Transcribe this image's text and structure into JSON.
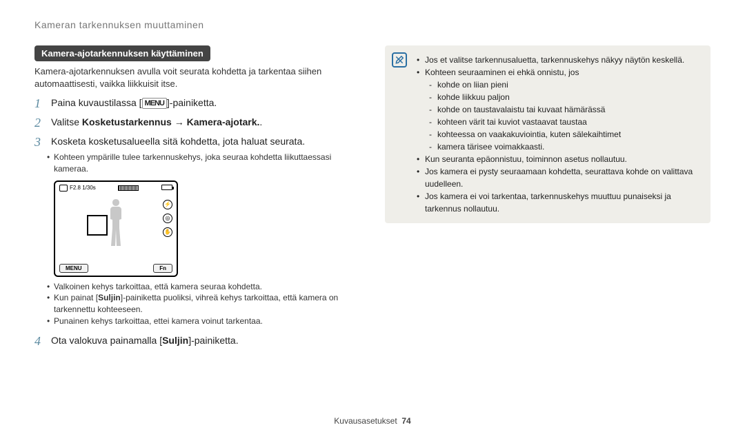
{
  "header": {
    "title": "Kameran tarkennuksen muuttaminen"
  },
  "section": {
    "title": "Kamera-ajotarkennuksen käyttäminen"
  },
  "intro": "Kamera-ajotarkennuksen avulla voit seurata kohdetta ja tarkentaa siihen automaattisesti, vaikka liikkuisit itse.",
  "menu_label": "MENU",
  "steps": {
    "s1": {
      "num": "1",
      "pre": "Paina kuvaustilassa [",
      "post": "]-painiketta."
    },
    "s2": {
      "num": "2",
      "pre": "Valitse ",
      "b1": "Kosketustarkennus",
      "arrow": " → ",
      "b2": "Kamera-ajotark.",
      "post": "."
    },
    "s3": {
      "num": "3",
      "text": "Kosketa kosketusalueella sitä kohdetta, jota haluat seurata."
    },
    "s3_sub": "Kohteen ympärille tulee tarkennuskehys, joka seuraa kohdetta liikuttaessasi kameraa.",
    "s4": {
      "num": "4",
      "pre": "Ota valokuva painamalla [",
      "b": "Suljin",
      "post": "]-painiketta."
    }
  },
  "camera": {
    "fstop": "F2.8 1/30s",
    "menu": "MENU",
    "fn": "Fn"
  },
  "frame_notes": {
    "a": "Valkoinen kehys tarkoittaa, että kamera seuraa kohdetta.",
    "b_pre": "Kun painat [",
    "b_b": "Suljin",
    "b_post": "]-painiketta puoliksi, vihreä kehys tarkoittaa, että kamera on tarkennettu kohteeseen.",
    "c": "Punainen kehys tarkoittaa, ettei kamera voinut tarkentaa."
  },
  "note_box": {
    "l1": "Jos et valitse tarkennusaluetta, tarkennuskehys näkyy näytön keskellä.",
    "l2": "Kohteen seuraaminen ei ehkä onnistu, jos",
    "l2a": "kohde on liian pieni",
    "l2b": "kohde liikkuu paljon",
    "l2c": "kohde on taustavalaistu tai kuvaat hämärässä",
    "l2d": "kohteen värit tai kuviot vastaavat taustaa",
    "l2e": "kohteessa on vaakakuviointia, kuten sälekaihtimet",
    "l2f": "kamera tärisee voimakkaasti.",
    "l3": "Kun seuranta epäonnistuu, toiminnon asetus nollautuu.",
    "l4": "Jos kamera ei pysty seuraamaan kohdetta, seurattava kohde on valittava uudelleen.",
    "l5": "Jos kamera ei voi tarkentaa, tarkennuskehys muuttuu punaiseksi ja tarkennus nollautuu."
  },
  "footer": {
    "label": "Kuvausasetukset",
    "page": "74"
  }
}
